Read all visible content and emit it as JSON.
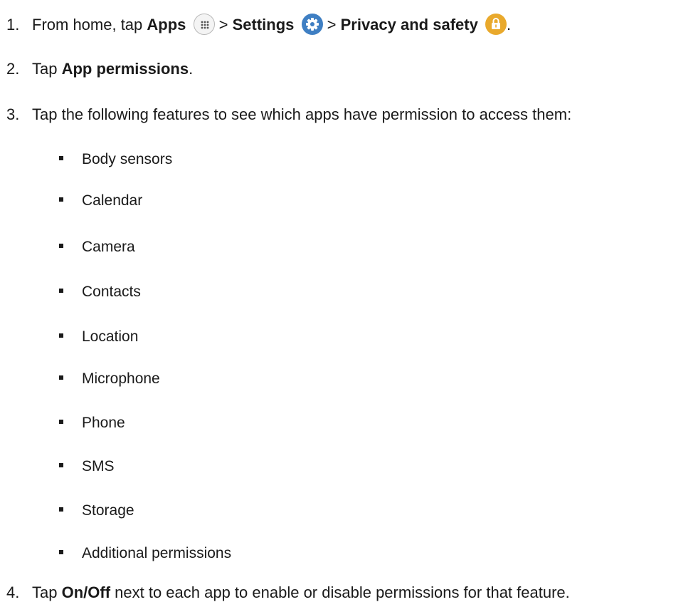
{
  "steps": {
    "s1": {
      "num": "1.",
      "pre": "From home, tap ",
      "apps": "Apps",
      "sep1": " > ",
      "settings": "Settings",
      "sep2": " > ",
      "privacy": "Privacy and safety",
      "end": "."
    },
    "s2": {
      "num": "2.",
      "pre": "Tap ",
      "bold": "App permissions",
      "end": "."
    },
    "s3": {
      "num": "3.",
      "text": "Tap the following features to see which apps have permission to access them:"
    },
    "s4": {
      "num": "4.",
      "pre": "Tap ",
      "bold": "On/Off",
      "post": " next to each app to enable or disable permissions for that feature."
    }
  },
  "features": [
    "Body sensors",
    "Calendar",
    "Camera",
    "Contacts",
    "Location",
    "Microphone",
    "Phone",
    "SMS",
    "Storage",
    "Additional permissions"
  ],
  "icons": {
    "apps": "apps-grid-icon",
    "settings": "settings-gear-icon",
    "privacy": "privacy-lock-icon"
  },
  "colors": {
    "settings_icon": "#3f7fc3",
    "privacy_icon": "#e9a92c",
    "text": "#1a1a1a"
  }
}
